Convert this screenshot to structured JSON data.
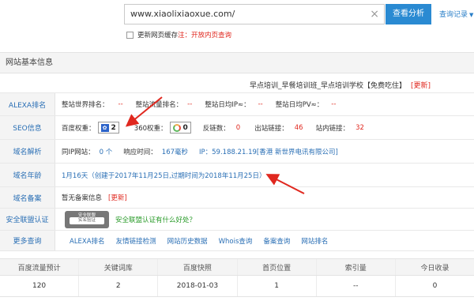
{
  "search": {
    "value": "www.xiaolixiaoxue.com/",
    "clear_icon": "×",
    "button_label": "查看分析",
    "history_label": "查询记录",
    "history_arrow": "▼",
    "cache_label": "更新网页缓存",
    "cache_note": "注：开放内页查询"
  },
  "section_title": "网站基本信息",
  "site": {
    "title": "早点培训_早餐培训班_早点培训学校【免费吃住】",
    "update_label": "[更新]"
  },
  "alexa": {
    "label": "ALEXA排名",
    "world_rank_label": "整站世界排名：",
    "world_rank": "--",
    "traffic_rank_label": "整站流量排名：",
    "traffic_rank": "--",
    "ip_label": "整站日均IP≈：",
    "ip": "--",
    "pv_label": "整站日均PV≈：",
    "pv": "--"
  },
  "seo": {
    "label": "SEO信息",
    "baidu_label": "百度权重：",
    "baidu_icon": "✿",
    "baidu_value": "2",
    "s360_label": "360权重：",
    "s360_value": "0",
    "backlinks_label": "反链数：",
    "backlinks": "0",
    "outlinks_label": "出站链接：",
    "outlinks": "46",
    "inlinks_label": "站内链接：",
    "inlinks": "32"
  },
  "dns": {
    "label": "域名解析",
    "same_ip_label": "同IP网站：",
    "same_ip": "0 个",
    "response_label": "响应时间：",
    "response": "167毫秒",
    "ip_text": "IP：59.188.21.19[香港 新世界电讯有限公司]"
  },
  "age": {
    "label": "域名年龄",
    "text": "1月16天（创建于2017年11月25日,过期时间为2018年11月25日）"
  },
  "beian": {
    "label": "域名备案",
    "text": "暂无备案信息",
    "update_label": "[更新]"
  },
  "security": {
    "label": "安全联盟认证",
    "badge_top": "安全联盟",
    "badge_main": "实名验证",
    "link_text": "安全联盟认证有什么好处？"
  },
  "more": {
    "label": "更多查询",
    "links": [
      "ALEXA排名",
      "友情链接检测",
      "网站历史数据",
      "Whois查询",
      "备案查询",
      "网站排名"
    ]
  },
  "table": {
    "headers": [
      "百度流量预计",
      "关键词库",
      "百度快照",
      "首页位置",
      "索引量",
      "今日收录"
    ],
    "values": [
      "120",
      "2",
      "2018-01-03",
      "1",
      "--",
      "0"
    ]
  },
  "colors": {
    "accent": "#2a8ad2",
    "link": "#2a6fb5",
    "warning": "#e0281f",
    "arrow": "#e0281f"
  }
}
